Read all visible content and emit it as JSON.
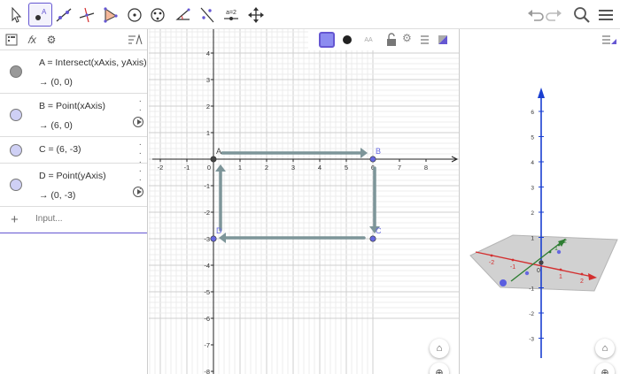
{
  "toolbar": {
    "tools": [
      {
        "id": "move",
        "icon": "move-arrow-icon"
      },
      {
        "id": "point",
        "icon": "point-icon",
        "label": "A",
        "active": true
      },
      {
        "id": "line",
        "icon": "line-icon"
      },
      {
        "id": "perpendicular",
        "icon": "perpendicular-line-icon"
      },
      {
        "id": "polygon",
        "icon": "polygon-icon"
      },
      {
        "id": "circle",
        "icon": "circle-icon"
      },
      {
        "id": "ellipse",
        "icon": "ellipse-icon"
      },
      {
        "id": "angle",
        "icon": "angle-icon"
      },
      {
        "id": "reflect",
        "icon": "reflect-icon"
      },
      {
        "id": "slider",
        "icon": "slider-icon",
        "label": "a=2"
      },
      {
        "id": "move-view",
        "icon": "move-graphics-view-icon"
      }
    ],
    "undo_icon": "undo-icon",
    "redo_icon": "redo-icon",
    "search_icon": "search-icon",
    "menu_icon": "menu-icon"
  },
  "algebra": {
    "header_icons": [
      "algebra-view-icon",
      "fx-icon",
      "gear-icon",
      "sort-icon"
    ],
    "items": [
      {
        "name": "A",
        "definition": "A = Intersect(xAxis, yAxis)",
        "value": "→  (0, 0)",
        "color": "#999999",
        "has_play": false
      },
      {
        "name": "B",
        "definition": "B = Point(xAxis)",
        "value": "→  (6, 0)",
        "color": "#cfd0f5",
        "has_play": true
      },
      {
        "name": "C",
        "definition": "C = (6, -3)",
        "value": "",
        "color": "#cfd0f5",
        "has_play": false
      },
      {
        "name": "D",
        "definition": "D = Point(yAxis)",
        "value": "→  (0, -3)",
        "color": "#cfd0f5",
        "has_play": true
      }
    ],
    "input_placeholder": "Input...",
    "input_icon": "plus-icon",
    "menu_icon": "more-vertical-icon",
    "play_icon": "play-icon"
  },
  "graphics": {
    "style_bar_icons": [
      "color-swatch-icon",
      "point-style-icon",
      "label-style-icon",
      "lock-icon",
      "gear-icon",
      "graphics-menu-icon",
      "toggle-panel-icon"
    ],
    "label_style_text": "AA",
    "x_ticks": [
      "-2",
      "-1",
      "0",
      "1",
      "2",
      "3",
      "4",
      "5",
      "6",
      "7",
      "8"
    ],
    "y_ticks": [
      "4",
      "3",
      "2",
      "1",
      "-1",
      "-2",
      "-3",
      "-4",
      "-5",
      "-6",
      "-7",
      "-8"
    ],
    "points": [
      {
        "name": "A",
        "x": 0,
        "y": 0,
        "color": "#444444"
      },
      {
        "name": "B",
        "x": 6,
        "y": 0,
        "color": "#6668e0"
      },
      {
        "name": "C",
        "x": 6,
        "y": -3,
        "color": "#6668e0"
      },
      {
        "name": "D",
        "x": 0,
        "y": -3,
        "color": "#6668e0"
      }
    ],
    "arrow_color": "#7d9599",
    "home_icon": "home-icon",
    "zoom_icon": "zoom-in-icon"
  },
  "graphics3d": {
    "menu_icon": "graphics3d-menu-icon",
    "z_ticks": [
      "6",
      "5",
      "4",
      "3",
      "2",
      "1",
      "-1",
      "-2",
      "-3"
    ],
    "x_ticks": [
      "-2",
      "-1",
      "1",
      "2"
    ],
    "y_ticks": [
      "1",
      "2"
    ],
    "origin_label": "0",
    "home_icon": "home-icon",
    "zoom_icon": "zoom-in-icon",
    "axis_colors": {
      "x": "#d32f2f",
      "y": "#2e7d32",
      "z": "#1a3fd0"
    }
  }
}
